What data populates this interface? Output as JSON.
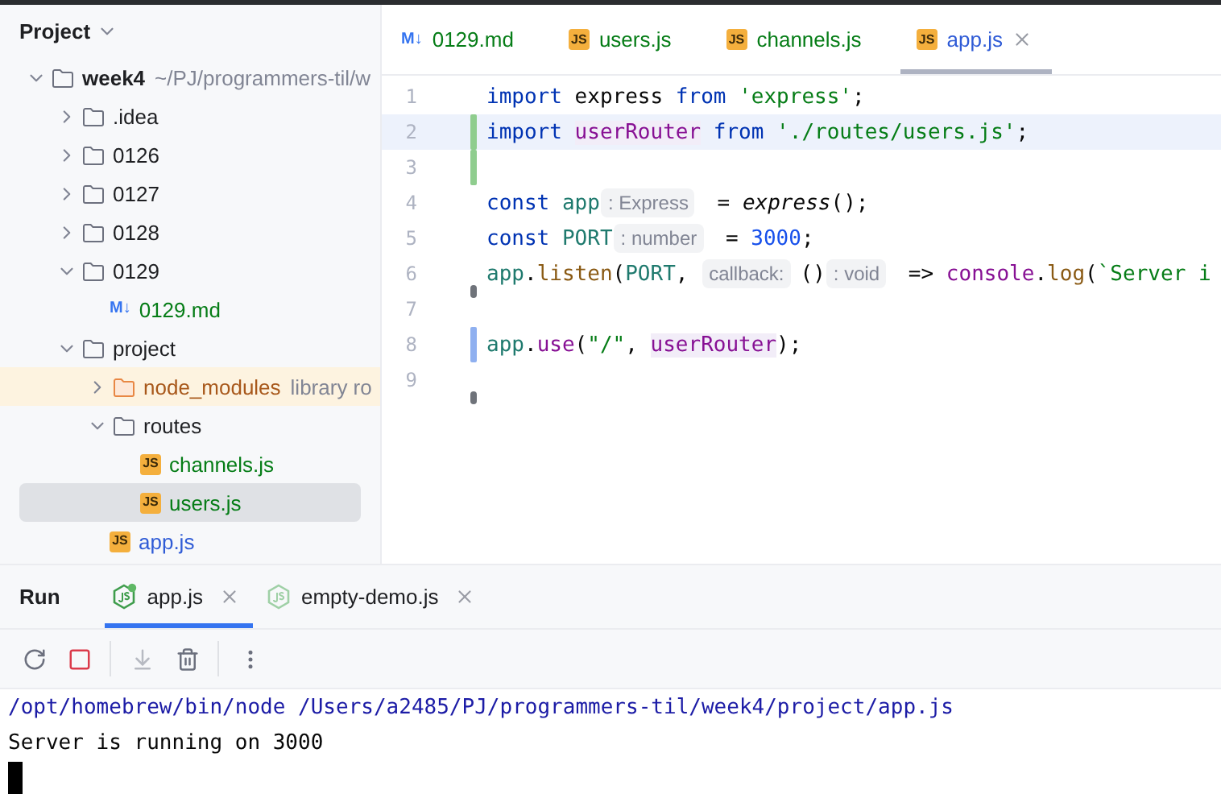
{
  "sidebar": {
    "title": "Project",
    "tree": [
      {
        "label": "week4",
        "kind": "folder",
        "expanded": true,
        "bold": true,
        "note": "~/PJ/programmers-til/w",
        "children": [
          {
            "label": ".idea",
            "kind": "folder",
            "expanded": false
          },
          {
            "label": "0126",
            "kind": "folder",
            "expanded": false
          },
          {
            "label": "0127",
            "kind": "folder",
            "expanded": false
          },
          {
            "label": "0128",
            "kind": "folder",
            "expanded": false
          },
          {
            "label": "0129",
            "kind": "folder",
            "expanded": true,
            "children": [
              {
                "label": "0129.md",
                "kind": "md",
                "icon_label": "M↓",
                "color": "#067d17",
                "selected": false
              }
            ]
          },
          {
            "label": "project",
            "kind": "folder",
            "expanded": true,
            "children": [
              {
                "label": "node_modules",
                "kind": "excluded",
                "expanded": false,
                "note": "library ro"
              },
              {
                "label": "routes",
                "kind": "folder",
                "expanded": true,
                "children": [
                  {
                    "label": "channels.js",
                    "kind": "js",
                    "icon_label": "JS",
                    "color": "#067d17",
                    "selected": false
                  },
                  {
                    "label": "users.js",
                    "kind": "js",
                    "icon_label": "JS",
                    "color": "#067d17",
                    "selected": true
                  }
                ]
              },
              {
                "label": "app.js",
                "kind": "js",
                "icon_label": "JS",
                "color": "#2f5bd6",
                "selected": false
              }
            ]
          }
        ]
      }
    ]
  },
  "editor": {
    "tabs": [
      {
        "label": "0129.md",
        "kind": "md",
        "icon_label": "M↓",
        "color": "#067d17",
        "selected": false
      },
      {
        "label": "users.js",
        "kind": "js",
        "icon_label": "JS",
        "color": "#067d17",
        "selected": false
      },
      {
        "label": "channels.js",
        "kind": "js",
        "icon_label": "JS",
        "color": "#067d17",
        "selected": false
      },
      {
        "label": "app.js",
        "kind": "js",
        "icon_label": "JS",
        "color": "#2f5bd6",
        "selected": true
      }
    ],
    "lines": [
      {
        "number": "1",
        "kind": "plain",
        "current": false,
        "tokens": [
          {
            "kind": "kw",
            "text": "import"
          },
          {
            "kind": "plain",
            "text": " express "
          },
          {
            "kind": "kw",
            "text": "from "
          },
          {
            "kind": "str",
            "text": "'express'"
          },
          {
            "kind": "plain",
            "text": ";"
          }
        ]
      },
      {
        "number": "2",
        "kind": "added",
        "current": true,
        "tokens": [
          {
            "kind": "kw",
            "text": "import "
          },
          {
            "kind": "usage",
            "text": "userRouter"
          },
          {
            "kind": "kw",
            "text": " from "
          },
          {
            "kind": "str",
            "text": "'./routes/users.js'"
          },
          {
            "kind": "plain",
            "text": ";"
          }
        ]
      },
      {
        "number": "3",
        "kind": "added",
        "current": false
      },
      {
        "number": "4",
        "kind": "plain",
        "current": false,
        "tokens": [
          {
            "kind": "kw",
            "text": "const "
          },
          {
            "kind": "var",
            "text": "app"
          },
          {
            "kind": "hint",
            "text": ": Express"
          },
          {
            "kind": "plain",
            "text": " = "
          },
          {
            "kind": "italic",
            "text": "express"
          },
          {
            "kind": "plain",
            "text": "();"
          }
        ]
      },
      {
        "number": "5",
        "kind": "plain",
        "current": false,
        "tokens": [
          {
            "kind": "kw",
            "text": "const "
          },
          {
            "kind": "var",
            "text": "PORT"
          },
          {
            "kind": "hint",
            "text": ": number"
          },
          {
            "kind": "plain",
            "text": " = "
          },
          {
            "kind": "num",
            "text": "3000"
          },
          {
            "kind": "plain",
            "text": ";"
          }
        ]
      },
      {
        "number": "6",
        "kind": "dot",
        "current": false,
        "tokens": [
          {
            "kind": "var",
            "text": "app"
          },
          {
            "kind": "plain",
            "text": "."
          },
          {
            "kind": "fn",
            "text": "listen"
          },
          {
            "kind": "plain",
            "text": "("
          },
          {
            "kind": "var",
            "text": "PORT"
          },
          {
            "kind": "plain",
            "text": ", "
          },
          {
            "kind": "hint",
            "text": "callback:"
          },
          {
            "kind": "plain",
            "text": "()"
          },
          {
            "kind": "hint",
            "text": ": void"
          },
          {
            "kind": "plain",
            "text": " => "
          },
          {
            "kind": "purple",
            "text": "console"
          },
          {
            "kind": "plain",
            "text": "."
          },
          {
            "kind": "fn",
            "text": "log"
          },
          {
            "kind": "plain",
            "text": "("
          },
          {
            "kind": "str",
            "text": "`Server i"
          }
        ]
      },
      {
        "number": "7",
        "kind": "plain",
        "current": false
      },
      {
        "number": "8",
        "kind": "modified",
        "current": false,
        "tokens": [
          {
            "kind": "var",
            "text": "app"
          },
          {
            "kind": "plain",
            "text": "."
          },
          {
            "kind": "purple",
            "text": "use"
          },
          {
            "kind": "plain",
            "text": "("
          },
          {
            "kind": "str",
            "text": "\"/\""
          },
          {
            "kind": "plain",
            "text": ", "
          },
          {
            "kind": "usage",
            "text": "userRouter"
          },
          {
            "kind": "plain",
            "text": ");"
          }
        ]
      },
      {
        "number": "9",
        "kind": "dot",
        "current": false
      }
    ]
  },
  "run_panel": {
    "title": "Run",
    "tabs": [
      {
        "label": "app.js",
        "running": true,
        "selected": true
      },
      {
        "label": "empty-demo.js",
        "running": false,
        "selected": false
      }
    ],
    "toolbar": [
      {
        "kind": "rerun",
        "disabled": false
      },
      {
        "kind": "stop",
        "disabled": false
      },
      {
        "kind": "separator"
      },
      {
        "kind": "scroll-end",
        "disabled": true
      },
      {
        "kind": "trash",
        "disabled": false
      },
      {
        "kind": "separator"
      },
      {
        "kind": "more",
        "disabled": false
      }
    ],
    "console": [
      {
        "kind": "command",
        "text": "/opt/homebrew/bin/node /Users/a2485/PJ/programmers-til/week4/project/app.js"
      },
      {
        "kind": "output",
        "text": "Server is running on 3000"
      }
    ]
  }
}
